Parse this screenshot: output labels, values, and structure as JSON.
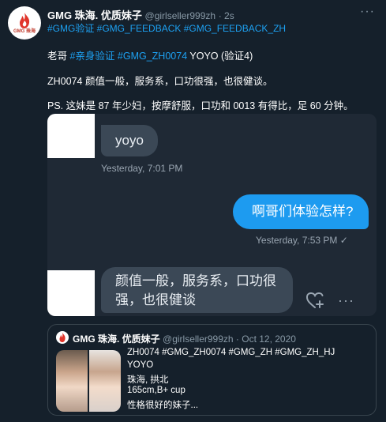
{
  "tweet": {
    "avatar_text": "GMG 珠海",
    "author_name": "GMG 珠海. 优质妹子",
    "handle": "@girlseller999zh",
    "time": "· 2s",
    "more": "···",
    "hashtags": "#GMG验证 #GMG_FEEDBACK #GMG_FEEDBACK_ZH",
    "line1_prefix": "老哥 ",
    "line1_tags": "#亲身验证 #GMG_ZH0074",
    "line1_suffix": " YOYO (验证4)",
    "line2": "ZH0074 颜值一般，服务系，口功很强，也很健谈。",
    "line3": "PS. 这妹是 87 年少妇，按摩舒服，口功和 0013 有得比，足 60 分钟。"
  },
  "chat": {
    "msg1": "yoyo",
    "msg1_time": "Yesterday, 7:01 PM",
    "msg2": "啊哥们体验怎样?",
    "msg2_time": "Yesterday, 7:53 PM ✓",
    "msg3_line1": "颜值一般，服务系，口功很",
    "msg3_line2": "强，也很健谈"
  },
  "quote": {
    "author_name": "GMG 珠海. 优质妹子",
    "handle": "@girlseller999zh · Oct 12, 2020",
    "lines": [
      "ZH0074 #GMG_ZH0074 #GMG_ZH #GMG_ZH_HJ",
      "YOYO",
      "珠海, 拱北",
      "165cm,B+ cup",
      "性格很好的妹子..."
    ]
  },
  "colors": {
    "background": "#15202b",
    "link": "#1da1f2",
    "outgoing_bubble": "#1d9bf0",
    "incoming_bubble": "#3b4856"
  }
}
